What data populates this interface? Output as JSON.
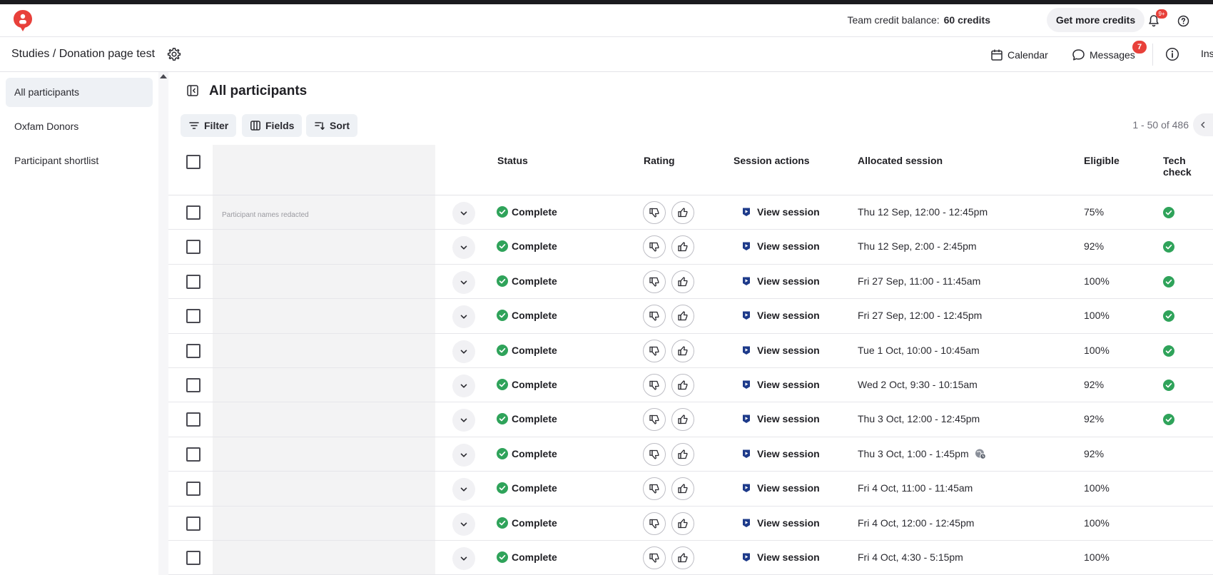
{
  "topbar": {
    "credit_label": "Team credit balance:",
    "credit_value": "60 credits",
    "get_more_label": "Get more credits",
    "notification_badge": "9+"
  },
  "subbar": {
    "breadcrumb": "Studies / Donation page test",
    "calendar_label": "Calendar",
    "messages_label": "Messages",
    "messages_badge": "7",
    "overflow_label": "Ins"
  },
  "sidebar": {
    "items": [
      {
        "label": "All participants",
        "active": true
      },
      {
        "label": "Oxfam Donors",
        "active": false
      },
      {
        "label": "Participant shortlist",
        "active": false
      }
    ]
  },
  "main": {
    "title": "All participants",
    "filter_label": "Filter",
    "fields_label": "Fields",
    "sort_label": "Sort",
    "pagination": "1 - 50 of 486",
    "redacted_note": "Participant names redacted"
  },
  "table": {
    "headers": {
      "status": "Status",
      "rating": "Rating",
      "session_actions": "Session actions",
      "allocated_session": "Allocated session",
      "eligible": "Eligible",
      "tech_check": "Tech check"
    },
    "rows": [
      {
        "status": "Complete",
        "action": "View session",
        "session": "Thu 12 Sep, 12:00 - 12:45pm",
        "eligible": "75%",
        "tech_ok": true,
        "tz_icon": false
      },
      {
        "status": "Complete",
        "action": "View session",
        "session": "Thu 12 Sep, 2:00 - 2:45pm",
        "eligible": "92%",
        "tech_ok": true,
        "tz_icon": false
      },
      {
        "status": "Complete",
        "action": "View session",
        "session": "Fri 27 Sep, 11:00 - 11:45am",
        "eligible": "100%",
        "tech_ok": true,
        "tz_icon": false
      },
      {
        "status": "Complete",
        "action": "View session",
        "session": "Fri 27 Sep, 12:00 - 12:45pm",
        "eligible": "100%",
        "tech_ok": true,
        "tz_icon": false
      },
      {
        "status": "Complete",
        "action": "View session",
        "session": "Tue 1 Oct, 10:00 - 10:45am",
        "eligible": "100%",
        "tech_ok": true,
        "tz_icon": false
      },
      {
        "status": "Complete",
        "action": "View session",
        "session": "Wed 2 Oct, 9:30 - 10:15am",
        "eligible": "92%",
        "tech_ok": true,
        "tz_icon": false
      },
      {
        "status": "Complete",
        "action": "View session",
        "session": "Thu 3 Oct, 12:00 - 12:45pm",
        "eligible": "92%",
        "tech_ok": true,
        "tz_icon": false
      },
      {
        "status": "Complete",
        "action": "View session",
        "session": "Thu 3 Oct, 1:00 - 1:45pm",
        "eligible": "92%",
        "tech_ok": false,
        "tz_icon": true
      },
      {
        "status": "Complete",
        "action": "View session",
        "session": "Fri 4 Oct, 11:00 - 11:45am",
        "eligible": "100%",
        "tech_ok": false,
        "tz_icon": false
      },
      {
        "status": "Complete",
        "action": "View session",
        "session": "Fri 4 Oct, 12:00 - 12:45pm",
        "eligible": "100%",
        "tech_ok": false,
        "tz_icon": false
      },
      {
        "status": "Complete",
        "action": "View session",
        "session": "Fri 4 Oct, 4:30 - 5:15pm",
        "eligible": "100%",
        "tech_ok": false,
        "tz_icon": false
      }
    ]
  },
  "colors": {
    "brand": "#e8403a",
    "success": "#2fa35a",
    "session_icon": "#1d3a8a",
    "active_bg": "#eef1f5"
  },
  "icons": {
    "logo": "brand-logo-icon",
    "bell": "bell-icon",
    "help": "help-icon",
    "gear": "gear-icon",
    "calendar": "calendar-icon",
    "messages": "chat-bubble-icon",
    "info": "info-icon",
    "collapse": "sidebar-collapse-icon",
    "filter": "filter-icon",
    "fields": "columns-icon",
    "sort": "sort-icon",
    "chevron": "chevron-down-icon",
    "thumbs_down": "thumbs-down-icon",
    "thumbs_up": "thumbs-up-icon",
    "session": "play-session-icon",
    "check": "check-circle-icon",
    "timezone": "globe-clock-icon"
  }
}
